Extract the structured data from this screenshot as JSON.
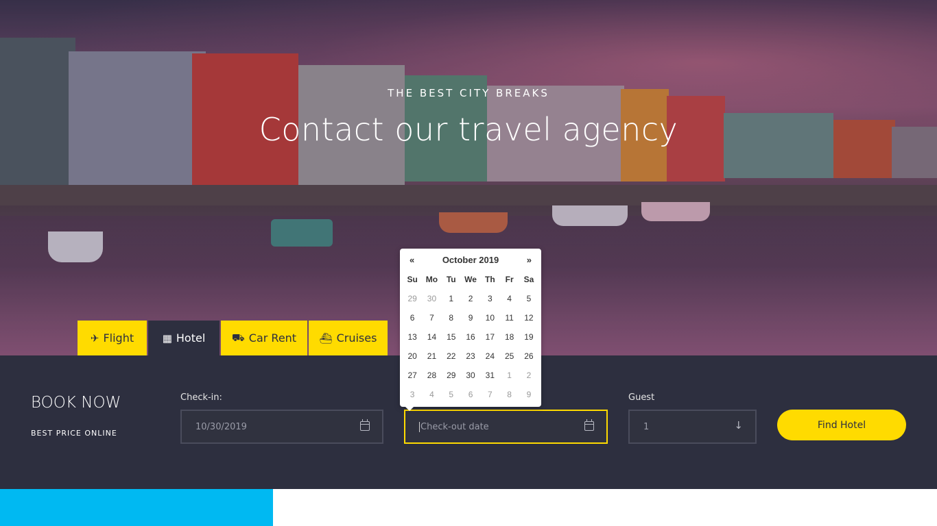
{
  "hero": {
    "subtitle": "THE BEST CITY BREAKS",
    "title": "Contact our travel agency"
  },
  "tabs": [
    {
      "label": "Flight",
      "icon": "plane-icon",
      "active": false
    },
    {
      "label": "Hotel",
      "icon": "hotel-icon",
      "active": true
    },
    {
      "label": "Car Rent",
      "icon": "car-icon",
      "active": false
    },
    {
      "label": "Cruises",
      "icon": "ship-icon",
      "active": false
    }
  ],
  "booking": {
    "title": "BOOK NOW",
    "subtitle": "BEST PRICE ONLINE",
    "checkin_label": "Check-in:",
    "checkin_value": "10/30/2019",
    "checkout_placeholder": "Check-out date",
    "guest_label": "Guest",
    "guest_value": "1",
    "find_label": "Find Hotel"
  },
  "datepicker": {
    "prev": "«",
    "next": "»",
    "month": "October 2019",
    "weekdays": [
      "Su",
      "Mo",
      "Tu",
      "We",
      "Th",
      "Fr",
      "Sa"
    ],
    "days": [
      [
        "29",
        "30",
        "1",
        "2",
        "3",
        "4",
        "5"
      ],
      [
        "6",
        "7",
        "8",
        "9",
        "10",
        "11",
        "12"
      ],
      [
        "13",
        "14",
        "15",
        "16",
        "17",
        "18",
        "19"
      ],
      [
        "20",
        "21",
        "22",
        "23",
        "24",
        "25",
        "26"
      ],
      [
        "27",
        "28",
        "29",
        "30",
        "31",
        "1",
        "2"
      ],
      [
        "3",
        "4",
        "5",
        "6",
        "7",
        "8",
        "9"
      ]
    ]
  },
  "colors": {
    "accent": "#ffdb00",
    "dark": "#2d2f3f",
    "blue": "#00b9f2"
  }
}
